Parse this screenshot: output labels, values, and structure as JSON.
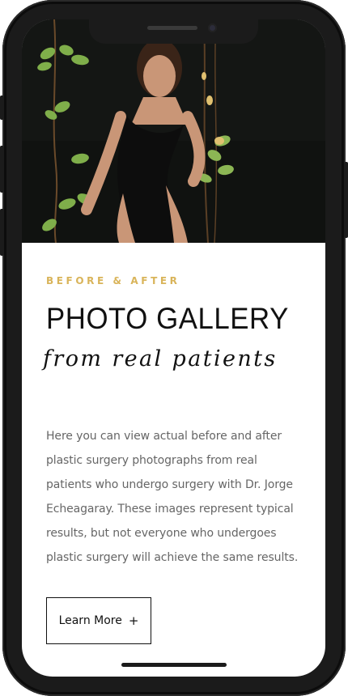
{
  "hero": {
    "image_alt": "model in black swimsuit among hanging vines"
  },
  "content": {
    "eyebrow": "BEFORE & AFTER",
    "title": "PHOTO GALLERY",
    "subtitle": "from real patients",
    "body": "Here you can view actual before and after plastic surgery photographs from real patients who undergo surgery with Dr. Jorge Echeagaray. These images represent typical results, but not everyone who undergoes plastic surgery will achieve the same results.",
    "cta_label": "Learn More",
    "cta_icon": "plus-icon"
  },
  "colors": {
    "accent": "#d9b45a",
    "text": "#111111",
    "body_text": "#666666",
    "frame": "#1b1b1b"
  }
}
